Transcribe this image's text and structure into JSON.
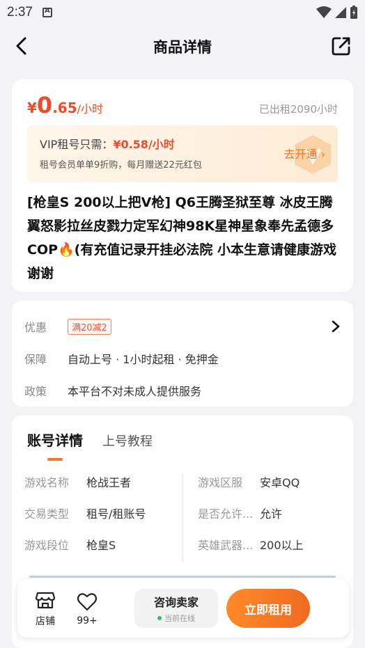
{
  "status_bar": {
    "time": "2:37"
  },
  "header": {
    "title": "商品详情"
  },
  "price": {
    "symbol": "¥",
    "integer": "0",
    "decimal": ".65",
    "unit": "/小时",
    "rented": "已出租2090小时"
  },
  "vip": {
    "label": "VIP租号只需：",
    "price": "¥0.58/小时",
    "desc": "租号会员单单9折购，每月赠送22元红包",
    "open_label": "去开通"
  },
  "goods_title": "[枪皇S 200以上把V枪] Q6王腾圣狱至尊 冰皮王腾翼怒影拉丝皮戮力定军幻神98K星神星象奉先孟德多COP🔥(有充值记录开挂必法院 小本生意请健康游戏 谢谢",
  "benefits": {
    "discount_key": "优惠",
    "discount_tag": "满20减2",
    "guarantee_key": "保障",
    "guarantee_value": "自动上号 · 1小时起租 · 免押金",
    "policy_key": "政策",
    "policy_value": "本平台不对未成人提供服务"
  },
  "tabs": {
    "active": "账号详情",
    "other": "上号教程"
  },
  "details": {
    "game_name_k": "游戏名称",
    "game_name_v": "枪战王者",
    "server_k": "游戏区服",
    "server_v": "安卓QQ",
    "trade_k": "交易类型",
    "trade_v": "租号/租账号",
    "allow_k": "是否允许...",
    "allow_v": "允许",
    "rank_k": "游戏段位",
    "rank_v": "枪皇S",
    "weapon_k": "英雄武器...",
    "weapon_v": "200以上"
  },
  "bottom": {
    "shop_label": "店铺",
    "fav_count": "99+",
    "consult_label": "咨询卖家",
    "online_label": "当前在线",
    "rent_label": "立即租用"
  },
  "colors": {
    "accent": "#f04a2a",
    "button": "#f5772c"
  }
}
